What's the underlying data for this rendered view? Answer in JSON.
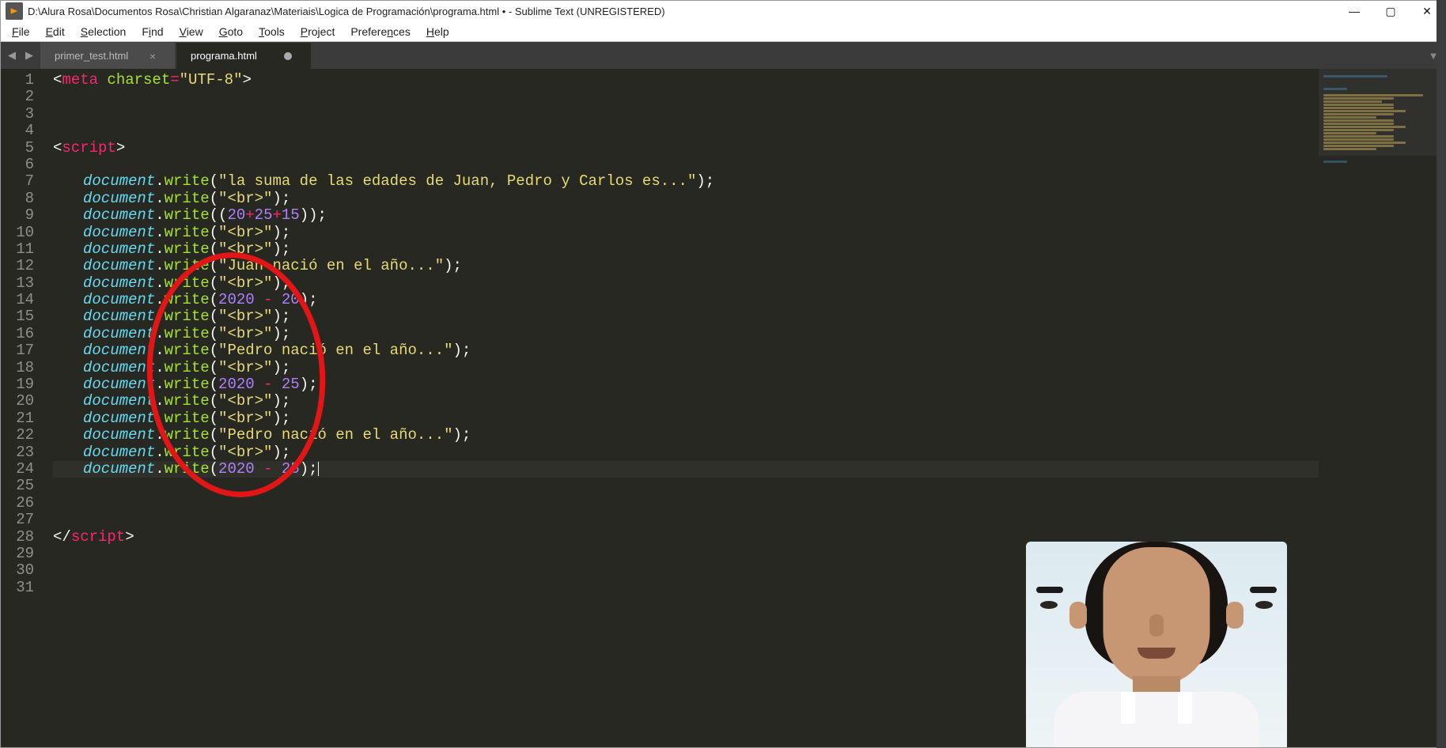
{
  "title": "D:\\Alura Rosa\\Documentos Rosa\\Christian Algaranaz\\Materiais\\Logica de Programación\\programa.html • - Sublime Text (UNREGISTERED)",
  "menus": [
    "File",
    "Edit",
    "Selection",
    "Find",
    "View",
    "Goto",
    "Tools",
    "Project",
    "Preferences",
    "Help"
  ],
  "tabs": [
    {
      "label": "primer_test.html",
      "active": false,
      "dirty": false
    },
    {
      "label": "programa.html",
      "active": true,
      "dirty": true
    }
  ],
  "line_count": 31,
  "current_line": 24,
  "code": {
    "l1": {
      "tag": "meta",
      "attr": "charset",
      "val": "\"UTF-8\""
    },
    "l5": {
      "tag": "script"
    },
    "doc": "document",
    "fn": "write",
    "l7": {
      "s": "\"la suma de las edades de Juan, Pedro y Carlos es...\""
    },
    "l8": {
      "s": "\"<br>\""
    },
    "l9": {
      "n1": "20",
      "n2": "25",
      "n3": "15"
    },
    "l10": {
      "s": "\"<br>\""
    },
    "l11": {
      "s": "\"<br>\""
    },
    "l12": {
      "s": "\"Juan nació en el año...\""
    },
    "l13": {
      "s": "\"<br>\""
    },
    "l14": {
      "n1": "2020",
      "n2": "20"
    },
    "l15": {
      "s": "\"<br>\""
    },
    "l16": {
      "s": "\"<br>\""
    },
    "l17": {
      "s": "\"Pedro nació en el año...\""
    },
    "l18": {
      "s": "\"<br>\""
    },
    "l19": {
      "n1": "2020",
      "n2": "25"
    },
    "l20": {
      "s": "\"<br>\""
    },
    "l21": {
      "s": "\"<br>\""
    },
    "l22": {
      "s": "\"Pedro nació en el año...\""
    },
    "l23": {
      "s": "\"<br>\""
    },
    "l24": {
      "n1": "2020",
      "n2": "25"
    },
    "l28": {
      "tag": "script"
    }
  }
}
